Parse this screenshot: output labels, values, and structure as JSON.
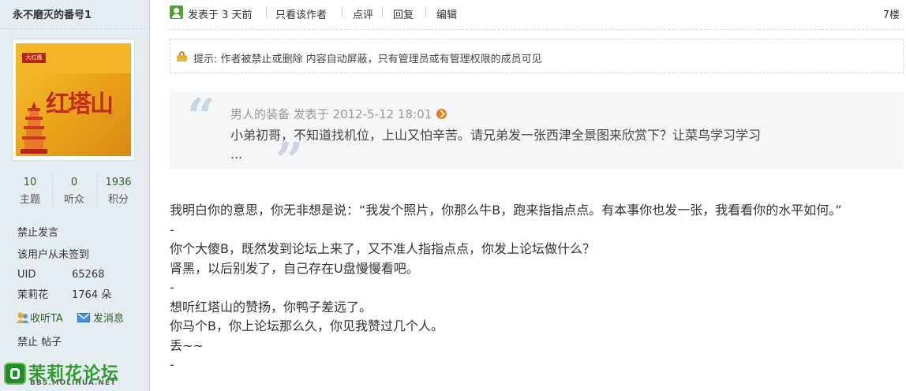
{
  "author": {
    "name": "永不磨灭的番号1",
    "avatar_text": "红塔山",
    "avatar_badge": "大红鹰",
    "stats": [
      {
        "value": "10",
        "label": "主题"
      },
      {
        "value": "0",
        "label": "听众"
      },
      {
        "value": "1936",
        "label": "积分"
      }
    ],
    "status_lines": [
      "禁止发言",
      "该用户从未签到"
    ],
    "uid_label": "UID",
    "uid_value": "65268",
    "flower_label": "茉莉花",
    "flower_value": "1764 朵",
    "follow_label": "收听TA",
    "message_label": "发消息",
    "ban_text": "禁止 帖子"
  },
  "logo": {
    "cn": "茉莉花论坛",
    "en": "BBS.MOLIHUA.NET"
  },
  "post_bar": {
    "posted": "发表于 3 天前",
    "only_author": "只看该作者",
    "comment": "点评",
    "reply": "回复",
    "edit": "编辑",
    "floor": "7楼"
  },
  "notice": "提示: 作者被禁止或删除 内容自动屏蔽，只有管理员或有管理权限的成员可见",
  "quote": {
    "header": "男人的装备 发表于 2012-5-12 18:01",
    "lines": [
      "小弟初哥，不知道找机位，上山又怕辛苦。请兄弟发一张西津全景图来欣赏下？让菜鸟学习学习",
      "..."
    ]
  },
  "body_lines": [
    "我明白你的意思，你无非想是说：“我发个照片，你那么牛B，跑来指指点点。有本事你也发一张，我看看你的水平如何。”",
    "-",
    "你个大傻B，既然发到论坛上来了，又不准人指指点点，你发上论坛做什么？",
    "肾黑，以后别发了，自己存在U盘慢慢看吧。",
    "-",
    "想听红塔山的赞扬，你鸭子差远了。",
    "你马个B，你上论坛那么久，你见我赞过几个人。",
    "丢~~",
    "-"
  ],
  "colors": {
    "sidebar_bg": "#e5edf2",
    "stat_green": "#335f2e",
    "logo_green": "#2f9a2e",
    "quote_bg": "#f4f6f8"
  }
}
